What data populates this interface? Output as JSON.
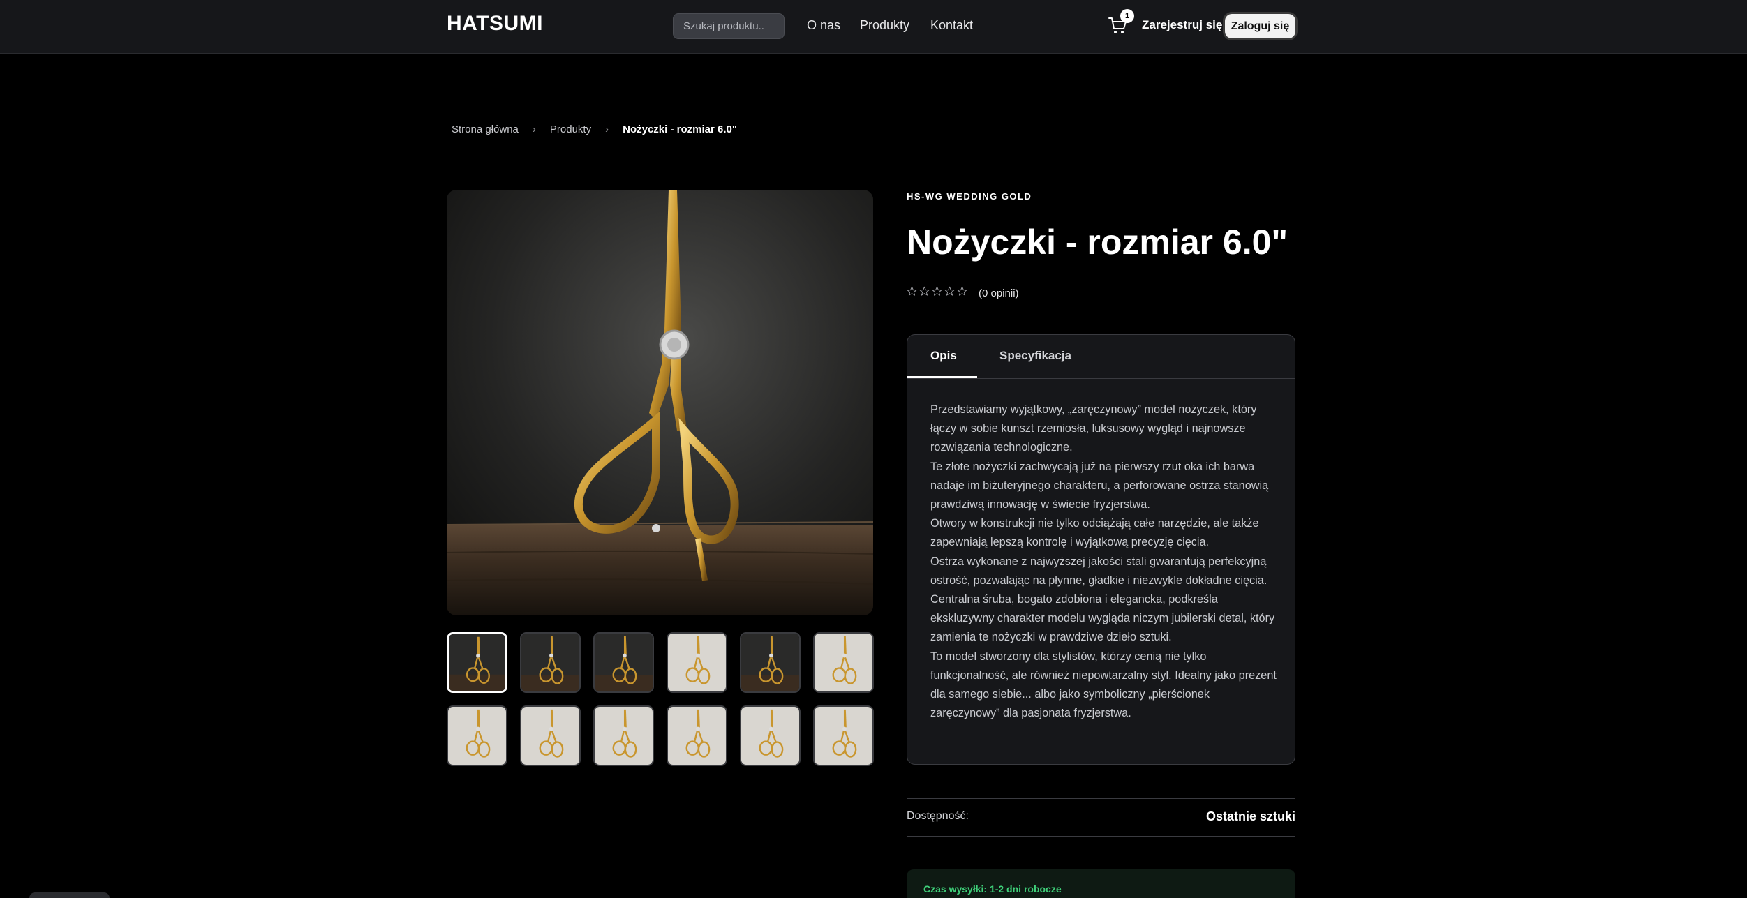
{
  "header": {
    "logo": "HATSUMI",
    "search_placeholder": "Szukaj produktu..",
    "nav": [
      "O nas",
      "Produkty",
      "Kontakt"
    ],
    "cart_count": "1",
    "register": "Zarejestruj się",
    "login": "Zaloguj się"
  },
  "breadcrumb": {
    "home": "Strona główna",
    "products": "Produkty",
    "current": "Nożyczki - rozmiar 6.0\""
  },
  "gallery": {
    "thumb_count": 12,
    "active_index": 0
  },
  "product": {
    "sku": "HS-WG WEDDING GOLD",
    "title": "Nożyczki - rozmiar 6.0\"",
    "rating": 0,
    "reviews": "(0 opinii)",
    "tabs": [
      "Opis",
      "Specyfikacja"
    ],
    "description": [
      "Przedstawiamy wyjątkowy, „zaręczynowy” model nożyczek, który łączy w sobie kunszt rzemiosła, luksusowy wygląd i najnowsze rozwiązania technologiczne.",
      "Te złote nożyczki zachwycają już na pierwszy rzut oka ich barwa nadaje im biżuteryjnego charakteru, a perforowane ostrza stanowią prawdziwą innowację w świecie fryzjerstwa.",
      "Otwory w konstrukcji nie tylko odciążają całe narzędzie, ale także zapewniają lepszą kontrolę i wyjątkową precyzję cięcia.",
      "Ostrza wykonane z najwyższej jakości stali gwarantują perfekcyjną ostrość, pozwalając na płynne, gładkie i niezwykle dokładne cięcia.",
      "Centralna śruba, bogato zdobiona i elegancka, podkreśla ekskluzywny charakter modelu wygląda niczym jubilerski detal, który zamienia te nożyczki w prawdziwe dzieło sztuki.",
      "To model stworzony dla stylistów, którzy cenią nie tylko funkcjonalność, ale również niepowtarzalny styl. Idealny jako prezent dla samego siebie... albo jako symboliczny „pierścionek zaręczynowy” dla pasjonata fryzjerstwa."
    ],
    "availability_label": "Dostępność:",
    "availability_value": "Ostatnie sztuki",
    "shipping": "Czas wysyłki: 1-2 dni robocze"
  },
  "colors": {
    "background": "#000000",
    "header": "#16171a",
    "gold": "#c9962e",
    "shipping_green": "#3fd17a"
  }
}
